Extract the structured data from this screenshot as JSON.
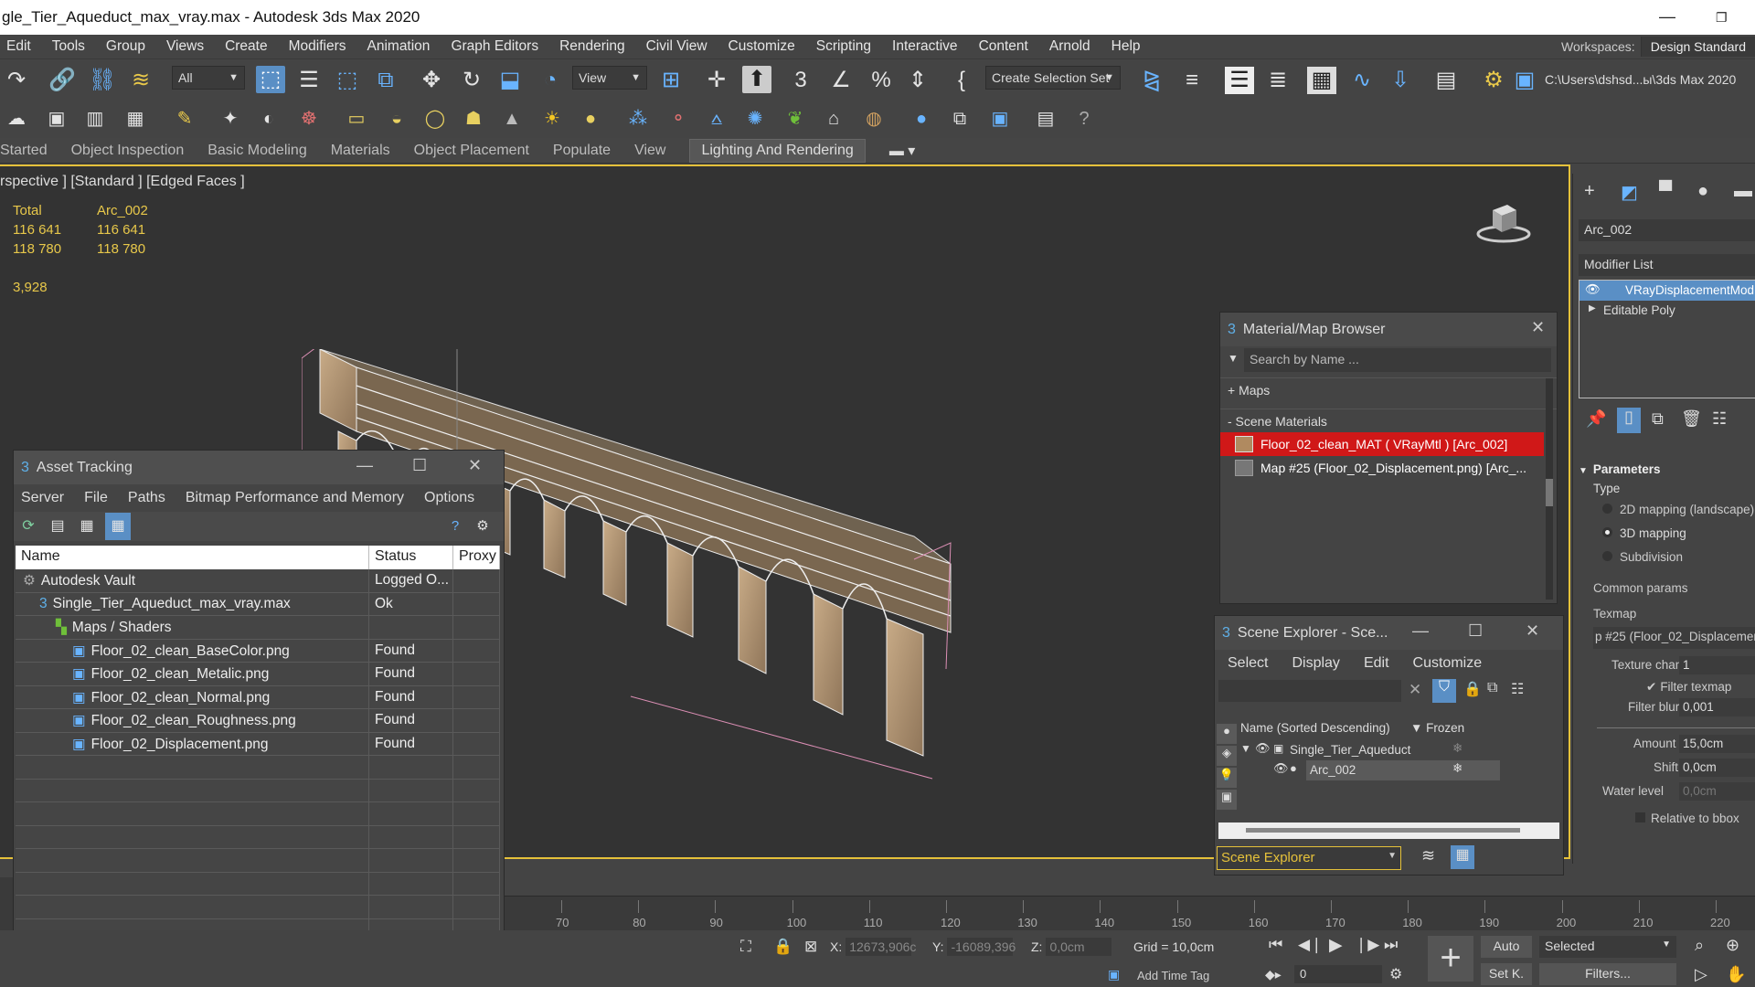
{
  "titlebar": {
    "title": "gle_Tier_Aqueduct_max_vray.max - Autodesk 3ds Max 2020"
  },
  "menu": [
    "Edit",
    "Tools",
    "Group",
    "Views",
    "Create",
    "Modifiers",
    "Animation",
    "Graph Editors",
    "Rendering",
    "Civil View",
    "Customize",
    "Scripting",
    "Interactive",
    "Content",
    "Arnold",
    "Help"
  ],
  "workspace": {
    "label": "Workspaces:",
    "value": "Design Standard"
  },
  "toolbar": {
    "filter": "All",
    "ref_coord": "View",
    "selection_set": "Create Selection Set",
    "project_path": "C:\\Users\\dshsd...ы\\3ds Max 2020"
  },
  "ribbon": {
    "tabs": [
      "Started",
      "Object Inspection",
      "Basic Modeling",
      "Materials",
      "Object Placement",
      "Populate",
      "View",
      "Lighting And Rendering"
    ],
    "active": "Lighting And Rendering"
  },
  "viewport": {
    "label": "rspective ] [Standard ] [Edged Faces ]",
    "stats": {
      "c1": "Total",
      "c2": "Arc_002",
      "r1c1": "116 641",
      "r1c2": "116 641",
      "r2c1": "118 780",
      "r2c2": "118 780",
      "fps": "3,928"
    }
  },
  "asset_tracking": {
    "title": "Asset Tracking",
    "menu": [
      "Server",
      "File",
      "Paths",
      "Bitmap Performance and Memory",
      "Options"
    ],
    "columns": [
      "Name",
      "Status",
      "Proxy"
    ],
    "rows": [
      {
        "name": "Autodesk Vault",
        "status": "Logged O...",
        "indent": 0
      },
      {
        "name": "Single_Tier_Aqueduct_max_vray.max",
        "status": "Ok",
        "indent": 1
      },
      {
        "name": "Maps / Shaders",
        "status": "",
        "indent": 2
      },
      {
        "name": "Floor_02_clean_BaseColor.png",
        "status": "Found",
        "indent": 3
      },
      {
        "name": "Floor_02_clean_Metalic.png",
        "status": "Found",
        "indent": 3
      },
      {
        "name": "Floor_02_clean_Normal.png",
        "status": "Found",
        "indent": 3
      },
      {
        "name": "Floor_02_clean_Roughness.png",
        "status": "Found",
        "indent": 3
      },
      {
        "name": "Floor_02_Displacement.png",
        "status": "Found",
        "indent": 3
      }
    ]
  },
  "material_browser": {
    "title": "Material/Map Browser",
    "search_placeholder": "Search by Name ...",
    "maps_label": "+ Maps",
    "scene_materials_label": "- Scene Materials",
    "items": [
      "Floor_02_clean_MAT  ( VRayMtl )  [Arc_002]",
      "Map #25 (Floor_02_Displacement.png)   [Arc_..."
    ]
  },
  "scene_explorer": {
    "title": "Scene Explorer - Sce...",
    "menu": [
      "Select",
      "Display",
      "Edit",
      "Customize"
    ],
    "col_name": "Name (Sorted Descending)",
    "col_frozen": "▼ Frozen",
    "items": [
      "Single_Tier_Aqueduct",
      "Arc_002"
    ],
    "footer": "Scene Explorer"
  },
  "command_panel": {
    "object_name": "Arc_002",
    "modifier_list": "Modifier List",
    "stack": [
      "VRayDisplacementMod",
      "Editable Poly"
    ],
    "params_title": "Parameters",
    "type_label": "Type",
    "type_options": [
      "2D mapping (landscape)",
      "3D mapping",
      "Subdivision"
    ],
    "common_params": "Common params",
    "texmap_label": "Texmap",
    "texmap_value": "p #25 (Floor_02_Displacemen",
    "texture_chan_label": "Texture chan",
    "texture_chan_value": "1",
    "filter_texmap": "Filter texmap",
    "filter_blur_label": "Filter blur",
    "filter_blur_value": "0,001",
    "amount_label": "Amount",
    "amount_value": "15,0cm",
    "shift_label": "Shift",
    "shift_value": "0,0cm",
    "water_label": "Water level",
    "water_value": "0,0cm",
    "relative_bbox": "Relative to bbox"
  },
  "timeline": {
    "ticks": [
      "70",
      "80",
      "90",
      "100",
      "110",
      "120",
      "130",
      "140",
      "150",
      "160",
      "170",
      "180",
      "190",
      "200",
      "210",
      "220"
    ]
  },
  "status": {
    "x_label": "X:",
    "x": "12673,906c",
    "y_label": "Y:",
    "y": "-16089,396",
    "z_label": "Z:",
    "z": "0,0cm",
    "grid": "Grid = 10,0cm",
    "add_time_tag": "Add Time Tag",
    "frame": "0",
    "auto": "Auto",
    "setk": "Set K.",
    "selected": "Selected",
    "filters": "Filters..."
  }
}
